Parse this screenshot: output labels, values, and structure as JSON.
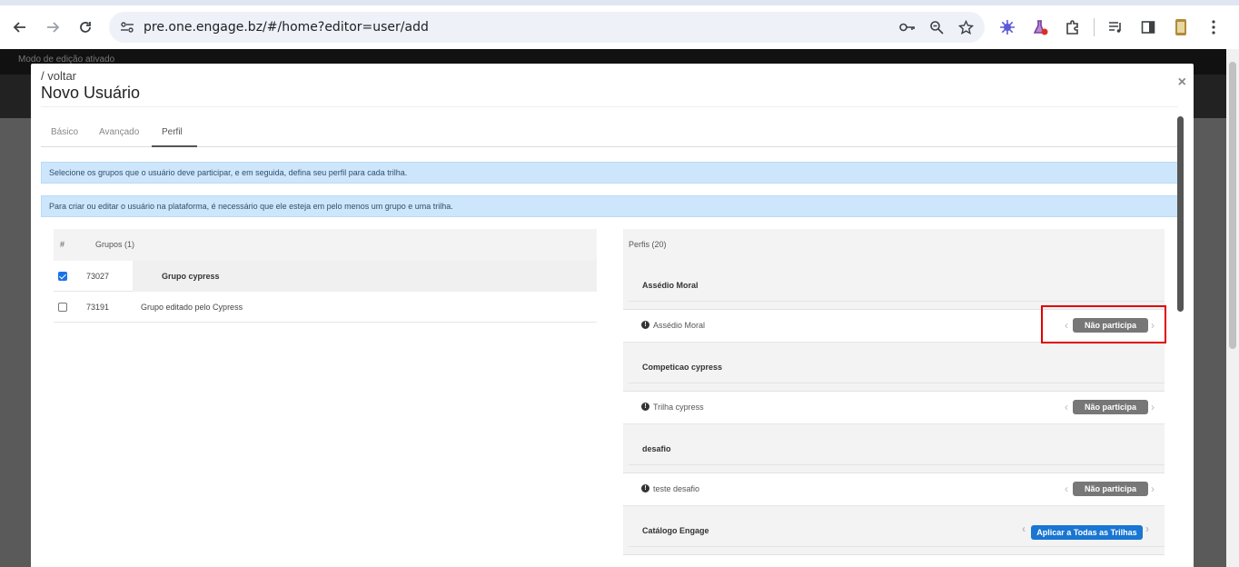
{
  "browser": {
    "url": "pre.one.engage.bz/#/home?editor=user/add",
    "back_icon": "arrow-left",
    "forward_icon": "arrow-right",
    "reload_icon": "reload"
  },
  "app": {
    "edit_mode_label": "Modo de edição ativado"
  },
  "modal": {
    "back_label": "/ voltar",
    "title": "Novo Usuário",
    "close_label": "×",
    "tabs": [
      {
        "label": "Básico",
        "active": false
      },
      {
        "label": "Avançado",
        "active": false
      },
      {
        "label": "Perfil",
        "active": true
      }
    ],
    "alerts": [
      "Selecione os grupos que o usuário deve participar, e em seguida, defina seu perfil para cada trilha.",
      "Para criar ou editar o usuário na plataforma, é necessário que ele esteja em pelo menos um grupo e uma trilha."
    ]
  },
  "groups": {
    "col_hash": "#",
    "col_groups": "Grupos (1)",
    "rows": [
      {
        "id": "73027",
        "name": "Grupo cypress",
        "checked": true
      },
      {
        "id": "73191",
        "name": "Grupo editado pelo Cypress",
        "checked": false
      }
    ]
  },
  "profiles": {
    "header": "Perfis (20)",
    "groups": [
      {
        "name": "Assédio Moral",
        "trail": "Assédio Moral",
        "status": "Não participa"
      },
      {
        "name": "Competicao cypress",
        "trail": "Trilha cypress",
        "status": "Não participa"
      },
      {
        "name": "desafio",
        "trail": "teste desafio",
        "status": "Não participa"
      },
      {
        "name": "Catálogo Engage",
        "apply_all": "Aplicar a Todas as Trilhas"
      }
    ]
  },
  "colors": {
    "alert_bg": "#cde6fb",
    "pill_grey": "#777777",
    "pill_blue": "#1976d2",
    "highlight": "#e00000"
  }
}
